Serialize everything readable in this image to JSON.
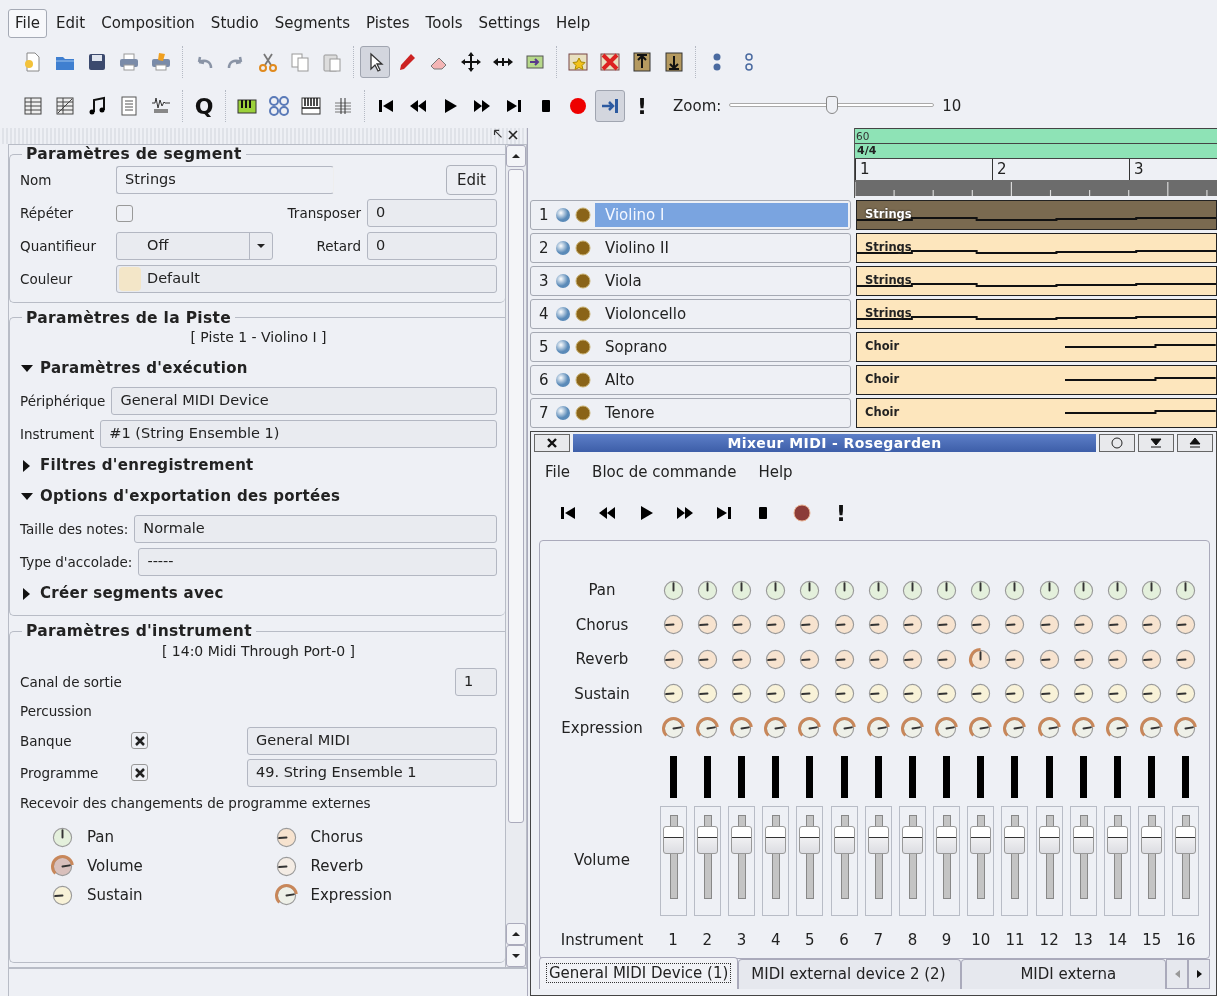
{
  "menu": [
    {
      "label": "File",
      "selected": true
    },
    {
      "label": "Edit",
      "selected": false
    },
    {
      "label": "Composition",
      "selected": false
    },
    {
      "label": "Studio",
      "selected": false
    },
    {
      "label": "Segments",
      "selected": false
    },
    {
      "label": "Pistes",
      "selected": false
    },
    {
      "label": "Tools",
      "selected": false
    },
    {
      "label": "Settings",
      "selected": false
    },
    {
      "label": "Help",
      "selected": false
    }
  ],
  "toolbar_1": [
    [
      {
        "selected": false
      },
      {
        "selected": false
      },
      {
        "selected": false
      },
      {
        "selected": false
      },
      {
        "selected": false
      }
    ],
    [
      {
        "selected": false
      },
      {
        "selected": false
      },
      {
        "selected": false
      },
      {
        "selected": false
      },
      {
        "selected": false
      }
    ],
    [
      {
        "selected": true
      },
      {
        "selected": false
      },
      {
        "selected": false
      },
      {
        "selected": false
      },
      {
        "selected": false
      },
      {
        "selected": false
      }
    ],
    [
      {
        "selected": false
      },
      {
        "selected": false
      },
      {
        "selected": false
      },
      {
        "selected": false
      }
    ],
    [
      {
        "selected": false
      },
      {
        "selected": false
      }
    ]
  ],
  "toolbar_2": [
    [
      {
        "selected": false
      },
      {
        "selected": false
      },
      {
        "selected": false
      },
      {
        "selected": false
      },
      {
        "selected": false
      }
    ],
    [
      {
        "label": "Q",
        "selected": false
      }
    ],
    [
      {
        "selected": false
      },
      {
        "selected": false
      },
      {
        "selected": false
      },
      {
        "selected": false
      }
    ],
    [
      {
        "selected": false
      },
      {
        "selected": false
      },
      {
        "selected": false
      },
      {
        "selected": false
      },
      {
        "selected": false
      },
      {
        "selected": false
      },
      {
        "selected": false
      },
      {
        "selected": true
      },
      {
        "label": "!",
        "selected": false
      }
    ]
  ],
  "zoom": {
    "label": "Zoom:",
    "level": 0.5,
    "value": "10"
  },
  "segment_parameters": {
    "title": "Paramètres de segment",
    "name_label": "Nom",
    "name_value": "Strings",
    "edit_button": "Edit",
    "repeat_label": "Répéter",
    "repeat_checked": false,
    "transpose_label": "Transposer",
    "transpose_value": "0",
    "quantize_label": "Quantifieur",
    "quantize_value": "Off",
    "delay_label": "Retard",
    "delay_value": "0",
    "color_label": "Couleur",
    "color": "#f3e6c8",
    "color_value": "Default"
  },
  "track_parameters": {
    "title": "Paramètres de la Piste",
    "subtitle": "[ Piste 1 - Violino I ]",
    "sections": [
      {
        "title": "Paramètres d'exécution",
        "expanded": true,
        "fields": [
          {
            "label": "Périphérique",
            "value": "General MIDI Device"
          },
          {
            "label": "Instrument",
            "value": "#1 (String Ensemble 1)"
          }
        ]
      },
      {
        "title": "Filtres d'enregistrement",
        "expanded": false
      },
      {
        "title": "Options d'exportation des portées",
        "expanded": true,
        "fields": [
          {
            "label": "Taille des notes:",
            "value": "Normale"
          },
          {
            "label": "Type d'accolade:",
            "value": "-----"
          }
        ]
      },
      {
        "title": "Créer segments avec",
        "expanded": false
      }
    ]
  },
  "instrument_parameters": {
    "title": "Paramètres d'instrument",
    "subtitle": "[ 14:0 Midi Through Port-0 ]",
    "channel_label": "Canal de sortie",
    "channel_value": "1",
    "percussion_label": "Percussion",
    "bank_label": "Banque",
    "bank_checked": true,
    "bank_value": "General MIDI",
    "program_label": "Programme",
    "program_checked": true,
    "program_value": "49. String Ensemble 1",
    "receive_label": "Recevoir des changements de programme externes",
    "knobs": [
      {
        "label": "Pan",
        "kind": "pan",
        "ring": false,
        "color": "#e4f0dc"
      },
      {
        "label": "Volume",
        "kind": "volume",
        "ring": true,
        "color": "#d9c0bc"
      },
      {
        "label": "Sustain",
        "kind": "sustain",
        "ring": false,
        "color": "#f8f2d8"
      },
      {
        "label": "Chorus",
        "kind": "chorus",
        "ring": false,
        "color": "#f7e3cf"
      },
      {
        "label": "Reverb",
        "kind": "reverb",
        "ring": false,
        "color": "#f4ece4"
      },
      {
        "label": "Expression",
        "kind": "expression",
        "ring": true,
        "color": "#eef0e8"
      }
    ]
  },
  "ruler": {
    "tempo": "60",
    "time_signature": "4/4",
    "bars": [
      "1",
      "2",
      "3"
    ]
  },
  "tracks": [
    {
      "number": "1",
      "name": "Violino I",
      "selected": true,
      "segment": {
        "label": "Strings",
        "selected": true
      }
    },
    {
      "number": "2",
      "name": "Violino II",
      "selected": false,
      "segment": {
        "label": "Strings",
        "selected": false
      }
    },
    {
      "number": "3",
      "name": "Viola",
      "selected": false,
      "segment": {
        "label": "Strings",
        "selected": false
      }
    },
    {
      "number": "4",
      "name": "Violoncello",
      "selected": false,
      "segment": {
        "label": "Strings",
        "selected": false
      }
    },
    {
      "number": "5",
      "name": "Soprano",
      "selected": false,
      "segment": {
        "label": "Choir",
        "selected": false
      }
    },
    {
      "number": "6",
      "name": "Alto",
      "selected": false,
      "segment": {
        "label": "Choir",
        "selected": false
      }
    },
    {
      "number": "7",
      "name": "Tenore",
      "selected": false,
      "segment": {
        "label": "Choir",
        "selected": false
      }
    }
  ],
  "mixer": {
    "title": "Mixeur MIDI - Rosegarden",
    "menu": [
      "File",
      "Bloc de commande",
      "Help"
    ],
    "transport": [
      {
        "selected": false
      },
      {
        "selected": false
      },
      {
        "selected": false
      },
      {
        "selected": false
      },
      {
        "selected": false
      },
      {
        "selected": false
      },
      {
        "selected": false
      },
      {
        "label": "!",
        "selected": false
      }
    ],
    "rows": [
      {
        "label": "Pan",
        "kind": "pan",
        "color": "#e4f0dc",
        "knobs": [
          {
            "ring": false
          },
          {
            "ring": false
          },
          {
            "ring": false
          },
          {
            "ring": false
          },
          {
            "ring": false
          },
          {
            "ring": false
          },
          {
            "ring": false
          },
          {
            "ring": false
          },
          {
            "ring": false
          },
          {
            "ring": false
          },
          {
            "ring": false
          },
          {
            "ring": false
          },
          {
            "ring": false
          },
          {
            "ring": false
          },
          {
            "ring": false
          },
          {
            "ring": false
          }
        ]
      },
      {
        "label": "Chorus",
        "kind": "chorus",
        "color": "#f7e3cf",
        "knobs": [
          {
            "ring": false
          },
          {
            "ring": false
          },
          {
            "ring": false
          },
          {
            "ring": false
          },
          {
            "ring": false
          },
          {
            "ring": false
          },
          {
            "ring": false
          },
          {
            "ring": false
          },
          {
            "ring": false
          },
          {
            "ring": false
          },
          {
            "ring": false
          },
          {
            "ring": false
          },
          {
            "ring": false
          },
          {
            "ring": false
          },
          {
            "ring": false
          },
          {
            "ring": false
          }
        ]
      },
      {
        "label": "Reverb",
        "kind": "reverb",
        "color": "#f7e3cf",
        "knobs": [
          {
            "ring": false
          },
          {
            "ring": false
          },
          {
            "ring": false
          },
          {
            "ring": false
          },
          {
            "ring": false
          },
          {
            "ring": false
          },
          {
            "ring": false
          },
          {
            "ring": false
          },
          {
            "ring": false
          },
          {
            "ring": true
          },
          {
            "ring": false
          },
          {
            "ring": false
          },
          {
            "ring": false
          },
          {
            "ring": false
          },
          {
            "ring": false
          },
          {
            "ring": false
          }
        ]
      },
      {
        "label": "Sustain",
        "kind": "sustain",
        "color": "#f8f2d8",
        "knobs": [
          {
            "ring": false
          },
          {
            "ring": false
          },
          {
            "ring": false
          },
          {
            "ring": false
          },
          {
            "ring": false
          },
          {
            "ring": false
          },
          {
            "ring": false
          },
          {
            "ring": false
          },
          {
            "ring": false
          },
          {
            "ring": false
          },
          {
            "ring": false
          },
          {
            "ring": false
          },
          {
            "ring": false
          },
          {
            "ring": false
          },
          {
            "ring": false
          },
          {
            "ring": false
          }
        ]
      },
      {
        "label": "Expression",
        "kind": "expression",
        "color": "#eef0e8",
        "knobs": [
          {
            "ring": true
          },
          {
            "ring": true
          },
          {
            "ring": true
          },
          {
            "ring": true
          },
          {
            "ring": true
          },
          {
            "ring": true
          },
          {
            "ring": true
          },
          {
            "ring": true
          },
          {
            "ring": true
          },
          {
            "ring": true
          },
          {
            "ring": true
          },
          {
            "ring": true
          },
          {
            "ring": true
          },
          {
            "ring": true
          },
          {
            "ring": true
          },
          {
            "ring": true
          }
        ]
      }
    ],
    "volume_label": "Volume",
    "faders": [
      {
        "level": 0.8
      },
      {
        "level": 0.8
      },
      {
        "level": 0.8
      },
      {
        "level": 0.8
      },
      {
        "level": 0.8
      },
      {
        "level": 0.8
      },
      {
        "level": 0.8
      },
      {
        "level": 0.8
      },
      {
        "level": 0.8
      },
      {
        "level": 0.8
      },
      {
        "level": 0.8
      },
      {
        "level": 0.8
      },
      {
        "level": 0.8
      },
      {
        "level": 0.8
      },
      {
        "level": 0.8
      },
      {
        "level": 0.8
      }
    ],
    "instrument_label": "Instrument",
    "channels": [
      "1",
      "2",
      "3",
      "4",
      "5",
      "6",
      "7",
      "8",
      "9",
      "10",
      "11",
      "12",
      "13",
      "14",
      "15",
      "16"
    ],
    "tabs": [
      {
        "label": "General MIDI Device (1)",
        "selected": true
      },
      {
        "label": "MIDI external device 2 (2)",
        "selected": false
      },
      {
        "label": "MIDI externa",
        "selected": false
      }
    ]
  }
}
